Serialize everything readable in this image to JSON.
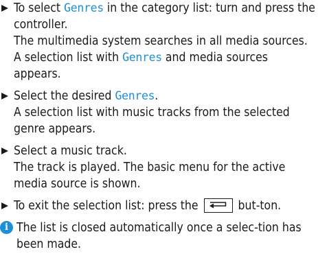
{
  "steps": [
    {
      "action_prefix": "To select ",
      "action_highlight": "Genres",
      "action_suffix": " in the category list: turn and press the controller.",
      "result_line1": "The multimedia system searches in all media sources. A selection list with ",
      "result_highlight": "Genres",
      "result_line2": " and media sources appears."
    },
    {
      "action_prefix": "Select the desired ",
      "action_highlight": "Genres",
      "action_suffix": ".",
      "result": "A selection list with music tracks from the selected genre appears."
    },
    {
      "action": "Select a music track.",
      "result": "The track is played. The basic menu for the active media source is shown."
    },
    {
      "action_prefix": "To exit the selection list: press the ",
      "button_icon": "back-arrow-icon",
      "action_suffix": " but-ton."
    }
  ],
  "note": {
    "icon": "info-icon",
    "icon_glyph": "i",
    "text": "The list is closed automatically once a selec-tion has been made."
  },
  "colors": {
    "highlight": "#1d8fd8",
    "text": "#1a1a1a"
  }
}
